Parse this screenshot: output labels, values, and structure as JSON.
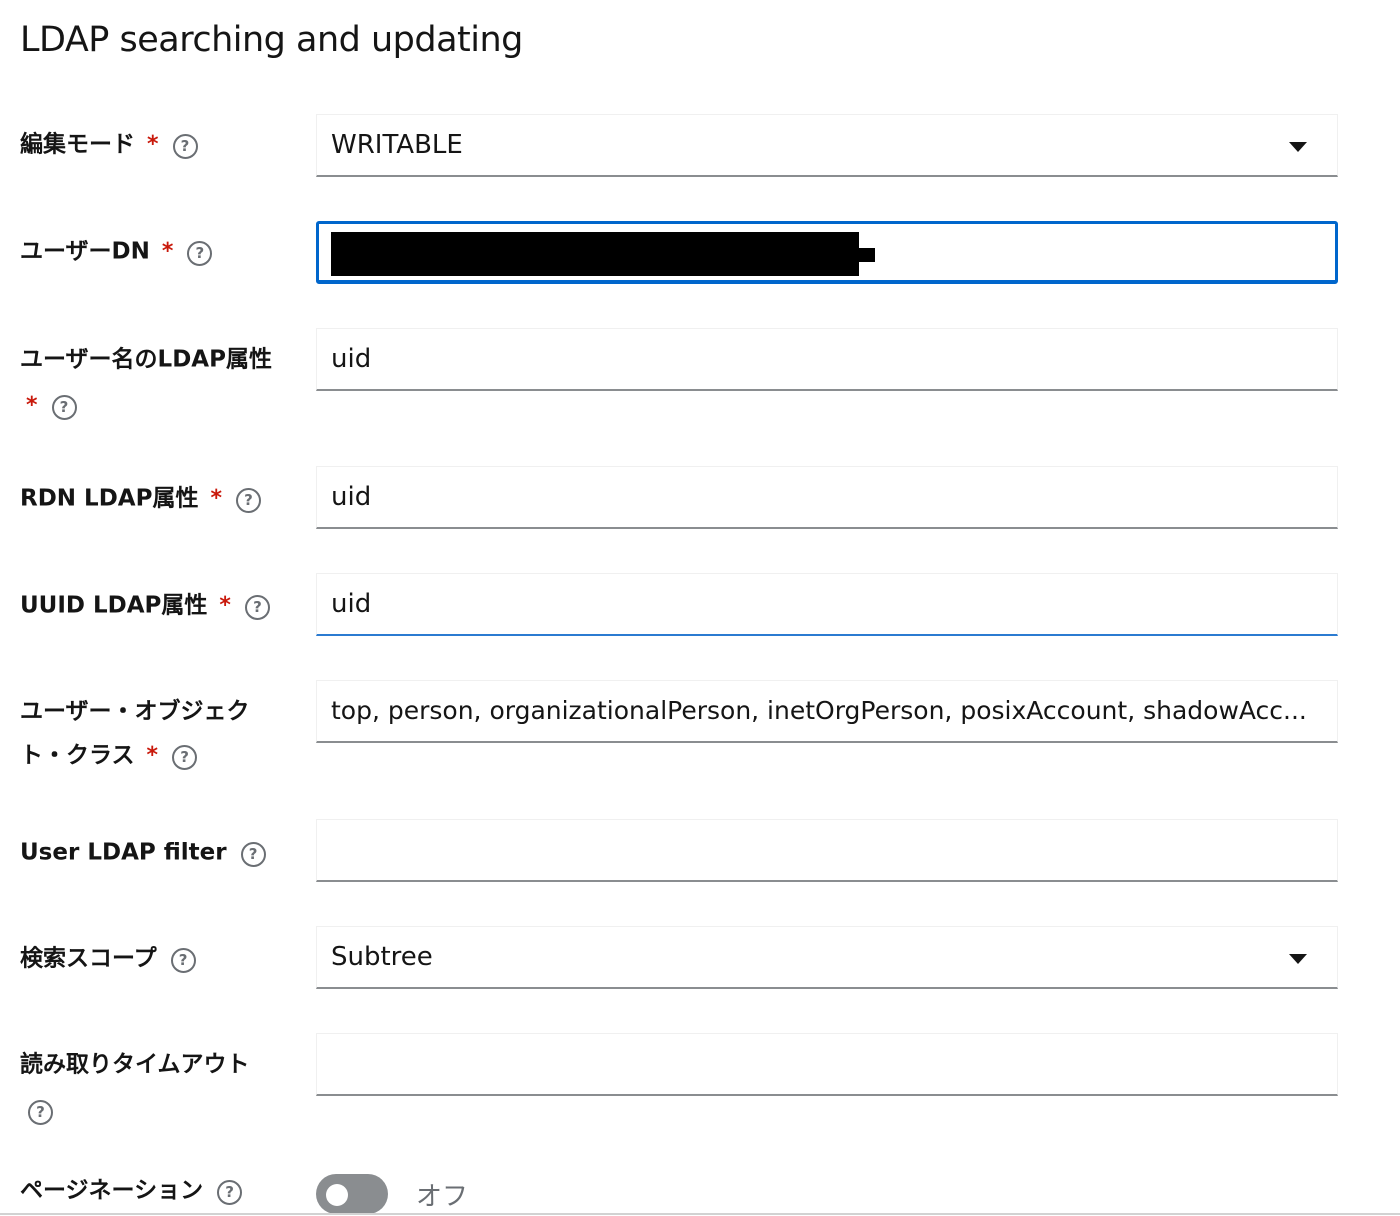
{
  "section": {
    "title": "LDAP searching and updating"
  },
  "fields": {
    "edit_mode": {
      "label": "編集モード",
      "required_mark": "*",
      "help_glyph": "?",
      "value": "WRITABLE",
      "icon": "caret-down-icon"
    },
    "users_dn": {
      "label": "ユーザーDN",
      "required_mark": "*",
      "help_glyph": "?",
      "value": "",
      "redacted": true
    },
    "username_attr": {
      "label_line1": "ユーザー名のLDAP属性",
      "required_mark": "*",
      "help_glyph": "?",
      "value": "uid"
    },
    "rdn_attr": {
      "label": "RDN LDAP属性",
      "required_mark": "*",
      "help_glyph": "?",
      "value": "uid"
    },
    "uuid_attr": {
      "label": "UUID LDAP属性",
      "required_mark": "*",
      "help_glyph": "?",
      "value": "uid"
    },
    "object_classes": {
      "label_line1": "ユーザー・オブジェク",
      "label_line2": "ト・クラス",
      "required_mark": "*",
      "help_glyph": "?",
      "value": "top, person, organizationalPerson, inetOrgPerson, posixAccount, shadowAcc..."
    },
    "user_filter": {
      "label": "User LDAP filter",
      "help_glyph": "?",
      "value": ""
    },
    "search_scope": {
      "label": "検索スコープ",
      "help_glyph": "?",
      "value": "Subtree",
      "icon": "caret-down-icon"
    },
    "read_timeout": {
      "label": "読み取りタイムアウト",
      "help_glyph": "?",
      "value": ""
    },
    "pagination": {
      "label": "ページネーション",
      "help_glyph": "?",
      "toggle_on": false,
      "toggle_text": "オフ"
    }
  },
  "colors": {
    "required": "#c9190b",
    "focus": "#0066cc",
    "help_icon": "#6a6e73",
    "toggle_off": "#8a8d90"
  }
}
